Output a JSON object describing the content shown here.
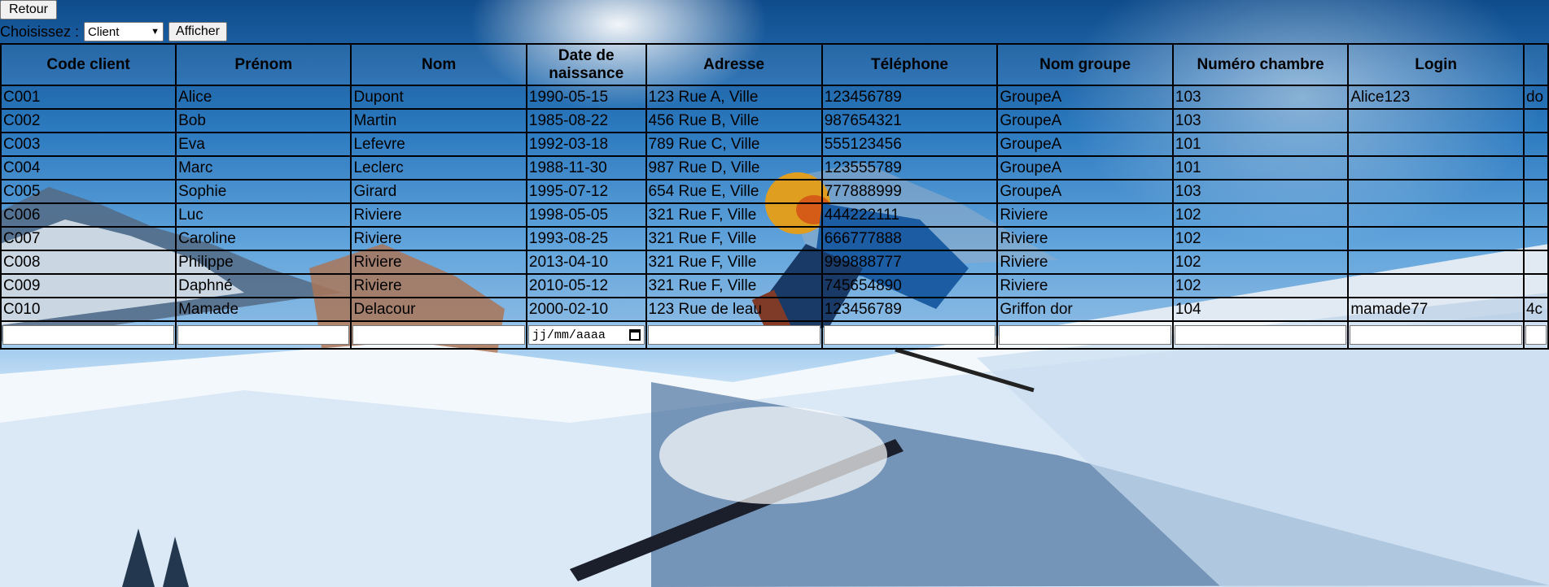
{
  "toolbar": {
    "back_label": "Retour",
    "choose_label": "Choisissez :",
    "select_value": "Client",
    "show_label": "Afficher"
  },
  "table": {
    "headers": [
      "Code client",
      "Prénom",
      "Nom",
      "Date de naissance",
      "Adresse",
      "Téléphone",
      "Nom groupe",
      "Numéro chambre",
      "Login",
      ""
    ],
    "rows": [
      [
        "C001",
        "Alice",
        "Dupont",
        "1990-05-15",
        "123 Rue A, Ville",
        "123456789",
        "GroupeA",
        "103",
        "Alice123",
        "do"
      ],
      [
        "C002",
        "Bob",
        "Martin",
        "1985-08-22",
        "456 Rue B, Ville",
        "987654321",
        "GroupeA",
        "103",
        "",
        ""
      ],
      [
        "C003",
        "Eva",
        "Lefevre",
        "1992-03-18",
        "789 Rue C, Ville",
        "555123456",
        "GroupeA",
        "101",
        "",
        ""
      ],
      [
        "C004",
        "Marc",
        "Leclerc",
        "1988-11-30",
        "987 Rue D, Ville",
        "123555789",
        "GroupeA",
        "101",
        "",
        ""
      ],
      [
        "C005",
        "Sophie",
        "Girard",
        "1995-07-12",
        "654 Rue E, Ville",
        "777888999",
        "GroupeA",
        "103",
        "",
        ""
      ],
      [
        "C006",
        "Luc",
        "Riviere",
        "1998-05-05",
        "321 Rue F, Ville",
        "444222111",
        "Riviere",
        "102",
        "",
        ""
      ],
      [
        "C007",
        "Caroline",
        "Riviere",
        "1993-08-25",
        "321 Rue F, Ville",
        "666777888",
        "Riviere",
        "102",
        "",
        ""
      ],
      [
        "C008",
        "Philippe",
        "Riviere",
        "2013-04-10",
        "321 Rue F, Ville",
        "999888777",
        "Riviere",
        "102",
        "",
        ""
      ],
      [
        "C009",
        "Daphné",
        "Riviere",
        "2010-05-12",
        "321 Rue F, Ville",
        "745654890",
        "Riviere",
        "102",
        "",
        ""
      ],
      [
        "C010",
        "Mamade",
        "Delacour",
        "2000-02-10",
        "123 Rue de leau",
        "123456789",
        "Griffon dor",
        "104",
        "mamade77",
        "4c"
      ]
    ],
    "date_placeholder": "jj/mm/aaaa"
  }
}
